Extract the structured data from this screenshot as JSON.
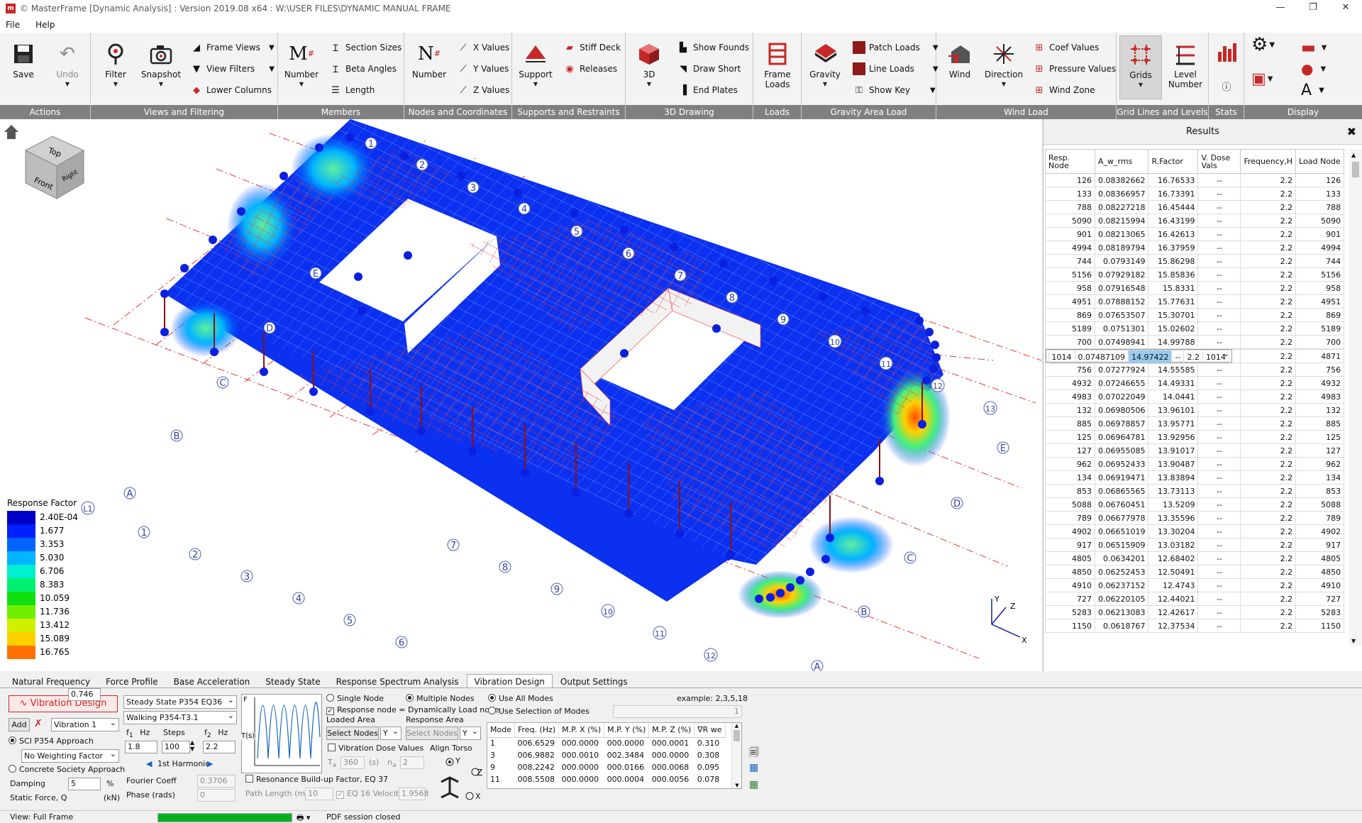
{
  "window": {
    "title": "© MasterFrame [Dynamic Analysis] : Version 2019.08 x64 : W:\\USER FILES\\DYNAMIC MANUAL FRAME",
    "minimize": "—",
    "restore": "❐",
    "close": "✕"
  },
  "menu": [
    "File",
    "Help"
  ],
  "ribbon": {
    "actions": {
      "label": "Actions",
      "save": "Save",
      "undo": "Undo"
    },
    "views": {
      "label": "Views and Filtering",
      "filter": "Filter",
      "snapshot": "Snapshot",
      "frame_views": "Frame Views",
      "view_filters": "View Filters",
      "lower_columns": "Lower Columns"
    },
    "members": {
      "label": "Members",
      "number": "Number",
      "section_sizes": "Section Sizes",
      "beta_angles": "Beta Angles",
      "length": "Length"
    },
    "nodes": {
      "label": "Nodes and Coordinates",
      "number": "Number",
      "x_values": "X Values",
      "y_values": "Y Values",
      "z_values": "Z Values"
    },
    "supports": {
      "label": "Supports and Restraints",
      "support": "Support",
      "stiff_deck": "Stiff Deck",
      "releases": "Releases"
    },
    "drawing3d": {
      "label": "3D Drawing",
      "btn3d": "3D",
      "show_founds": "Show Founds",
      "draw_short": "Draw Short",
      "end_plates": "End Plates"
    },
    "loads": {
      "label": "Loads",
      "frame_loads_1": "Frame",
      "frame_loads_2": "Loads"
    },
    "gravity": {
      "label": "Gravity Area Load",
      "gravity": "Gravity",
      "patch_loads": "Patch Loads",
      "line_loads": "Line Loads",
      "show_key": "Show Key"
    },
    "wind": {
      "label": "Wind Load",
      "wind": "Wind",
      "direction": "Direction",
      "coef_values": "Coef Values",
      "pressure_values": "Pressure Values",
      "wind_zone": "Wind Zone"
    },
    "grid": {
      "label": "Grid Lines and Levels",
      "grids": "Grids",
      "level_1": "Level",
      "level_2": "Number"
    },
    "stats": {
      "label": "Stats"
    },
    "display": {
      "label": "Display"
    }
  },
  "viewcube": {
    "top": "Top",
    "front": "Front",
    "right": "Right"
  },
  "legend": {
    "title": "Response Factor",
    "items": [
      {
        "value": "2.40E-04",
        "color": "#0000c8"
      },
      {
        "value": "1.677",
        "color": "#0020ff"
      },
      {
        "value": "3.353",
        "color": "#0064ff"
      },
      {
        "value": "5.030",
        "color": "#00b4ff"
      },
      {
        "value": "6.706",
        "color": "#00f0d0"
      },
      {
        "value": "8.383",
        "color": "#00f070"
      },
      {
        "value": "10.059",
        "color": "#10e010"
      },
      {
        "value": "11.736",
        "color": "#70f000"
      },
      {
        "value": "13.412",
        "color": "#d0f000"
      },
      {
        "value": "15.089",
        "color": "#ffd000"
      },
      {
        "value": "16.765",
        "color": "#ff7000"
      }
    ]
  },
  "grid_labels": {
    "rows_left": [
      "A",
      "B",
      "C",
      "D",
      "E"
    ],
    "rows_right": [
      "A",
      "B",
      "C",
      "D",
      "E"
    ],
    "cols_top": [
      "1",
      "2",
      "3",
      "4",
      "5",
      "6",
      "7",
      "8",
      "9",
      "10",
      "11",
      "12",
      "13"
    ],
    "cols_bottom": [
      "1",
      "2",
      "3",
      "4",
      "5",
      "6",
      "7",
      "8",
      "9",
      "10",
      "11",
      "12"
    ],
    "left_extra": "L1"
  },
  "axes": {
    "x": "X",
    "y": "Y",
    "z": "Z"
  },
  "results": {
    "title": "Results",
    "close": "✖",
    "columns": [
      "Resp. Node",
      "A_w_rms",
      "R.Factor",
      "V. Dose Vals",
      "Frequency,H",
      "Load Node"
    ],
    "selected_row": 10,
    "rows": [
      [
        "126",
        "0.08382662",
        "16.76533",
        "--",
        "2.2",
        "126"
      ],
      [
        "133",
        "0.08366957",
        "16.73391",
        "--",
        "2.2",
        "133"
      ],
      [
        "788",
        "0.08227218",
        "16.45444",
        "--",
        "2.2",
        "788"
      ],
      [
        "5090",
        "0.08215994",
        "16.43199",
        "--",
        "2.2",
        "5090"
      ],
      [
        "901",
        "0.08213065",
        "16.42613",
        "--",
        "2.2",
        "901"
      ],
      [
        "4994",
        "0.08189794",
        "16.37959",
        "--",
        "2.2",
        "4994"
      ],
      [
        "744",
        "0.0793149",
        "15.86298",
        "--",
        "2.2",
        "744"
      ],
      [
        "5156",
        "0.07929182",
        "15.85836",
        "--",
        "2.2",
        "5156"
      ],
      [
        "958",
        "0.07916548",
        "15.8331",
        "--",
        "2.2",
        "958"
      ],
      [
        "4951",
        "0.07888152",
        "15.77631",
        "--",
        "2.2",
        "4951"
      ],
      [
        "869",
        "0.07653507",
        "15.30701",
        "--",
        "2.2",
        "869"
      ],
      [
        "5189",
        "0.0751301",
        "15.02602",
        "--",
        "2.2",
        "5189"
      ],
      [
        "700",
        "0.07498941",
        "14.99788",
        "--",
        "2.2",
        "700"
      ],
      [
        "1014",
        "0.07487109",
        "14.97422",
        "--",
        "2.2",
        "1014"
      ],
      [
        "4871",
        "0.07458916",
        "14.91783",
        "--",
        "2.2",
        "4871"
      ],
      [
        "756",
        "0.07277924",
        "14.55585",
        "--",
        "2.2",
        "756"
      ],
      [
        "4932",
        "0.07246655",
        "14.49331",
        "--",
        "2.2",
        "4932"
      ],
      [
        "4983",
        "0.07022049",
        "14.0441",
        "--",
        "2.2",
        "4983"
      ],
      [
        "132",
        "0.06980506",
        "13.96101",
        "--",
        "2.2",
        "132"
      ],
      [
        "885",
        "0.06978857",
        "13.95771",
        "--",
        "2.2",
        "885"
      ],
      [
        "125",
        "0.06964781",
        "13.92956",
        "--",
        "2.2",
        "125"
      ],
      [
        "127",
        "0.06955085",
        "13.91017",
        "--",
        "2.2",
        "127"
      ],
      [
        "962",
        "0.06952433",
        "13.90487",
        "--",
        "2.2",
        "962"
      ],
      [
        "134",
        "0.06919471",
        "13.83894",
        "--",
        "2.2",
        "134"
      ],
      [
        "853",
        "0.06865565",
        "13.73113",
        "--",
        "2.2",
        "853"
      ],
      [
        "5088",
        "0.06760451",
        "13.5209",
        "--",
        "2.2",
        "5088"
      ],
      [
        "789",
        "0.06677978",
        "13.35596",
        "--",
        "2.2",
        "789"
      ],
      [
        "4902",
        "0.06651019",
        "13.30204",
        "--",
        "2.2",
        "4902"
      ],
      [
        "917",
        "0.06515909",
        "13.03182",
        "--",
        "2.2",
        "917"
      ],
      [
        "4805",
        "0.0634201",
        "12.68402",
        "--",
        "2.2",
        "4805"
      ],
      [
        "4850",
        "0.06252453",
        "12.50491",
        "--",
        "2.2",
        "4850"
      ],
      [
        "4910",
        "0.06237152",
        "12.4743",
        "--",
        "2.2",
        "4910"
      ],
      [
        "727",
        "0.06220105",
        "12.44021",
        "--",
        "2.2",
        "727"
      ],
      [
        "5283",
        "0.06213083",
        "12.42617",
        "--",
        "2.2",
        "5283"
      ],
      [
        "1150",
        "0.0618767",
        "12.37534",
        "--",
        "2.2",
        "1150"
      ]
    ]
  },
  "tabs": [
    "Natural Frequency",
    "Force Profile",
    "Base Acceleration",
    "Steady State",
    "Response Spectrum Analysis",
    "Vibration Design",
    "Output Settings"
  ],
  "active_tab": "Vibration Design",
  "vibration": {
    "header": "Vibration Design",
    "add": "Add",
    "design_select": "Vibration 1",
    "approach1": "SCI P354 Approach",
    "weighting": "No Weighting Factor",
    "approach2": "Concrete Society Approach",
    "damping_label": "Damping",
    "damping": "5",
    "damping_unit": "%",
    "force_label": "Static Force, Q",
    "force": "0.746",
    "force_unit": "(kN)",
    "method": "Steady State P354 EQ36",
    "walking": "Walking P354-T3.1",
    "f1_label": "f",
    "f1_sub": "1",
    "hz1": "Hz",
    "steps_label": "Steps",
    "f2_label": "f",
    "f2_sub": "2",
    "hz2": "Hz",
    "f1": "1.8",
    "steps": "100",
    "f2": "2.2",
    "harmonic": "1st Harmonic",
    "fourier_label": "Fourier Coeff",
    "fourier": "0.3706",
    "phase_label": "Phase (rads)",
    "phase": "0",
    "graph_f": "F",
    "graph_t": "T(s)",
    "single_node": "Single Node",
    "multiple_nodes": "Multiple Nodes",
    "response_eq": "Response node = Dynamically Load node",
    "loaded_area": "Loaded Area",
    "response_area": "Response Area",
    "select_nodes": "Select Nodes",
    "select_nodes_dis": "Select Nodes",
    "axis_y1": "Y",
    "axis_y2": "Y",
    "dose_values": "Vibration Dose Values",
    "ta_label": "T",
    "ta_sub": "a",
    "ta": "360",
    "ta_unit": "(s)",
    "na_label": "n",
    "na_sub": "a",
    "na": "2",
    "align_torso": "Align Torso",
    "torso_y": "Y",
    "torso_z": "Z",
    "torso_x": "X",
    "resonance": "Resonance Build-up Factor, EQ 37",
    "path_length_label": "Path Length (m)",
    "path_length": "10",
    "eq16": "EQ 16 Velocity",
    "eq16_val": "1.9568",
    "use_all_modes": "Use All Modes",
    "use_selection": "Use Selection of Modes",
    "example": "example: 2,3,5,18",
    "modes_input": "1",
    "modes_columns": [
      "Mode",
      "Freq. (Hz)",
      "M.P. X (%)",
      "M.P. Y (%)",
      "M.P. Z (%)",
      "∇R we"
    ],
    "modes_rows": [
      [
        "1",
        "006.6529",
        "000.0000",
        "000.0000",
        "000.0001",
        "0.310"
      ],
      [
        "3",
        "006.9882",
        "000.0010",
        "002.3484",
        "000.0000",
        "0.308"
      ],
      [
        "9",
        "008.2242",
        "000.0000",
        "000.0166",
        "000.0068",
        "0.095"
      ],
      [
        "11",
        "008.5508",
        "000.0000",
        "000.0004",
        "000.0056",
        "0.078"
      ]
    ]
  },
  "status": {
    "view": "View: Full Frame",
    "progress": 1.0,
    "pdf": "PDF session closed"
  }
}
